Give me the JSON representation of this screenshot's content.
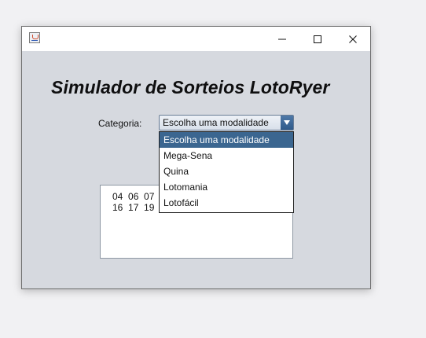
{
  "window": {
    "controls": {
      "minimize_glyph": "—",
      "maximize_glyph": "☐",
      "close_glyph": "✕"
    }
  },
  "app": {
    "title": "Simulador de Sorteios LotoRyer",
    "category_label": "Categoria:",
    "combo_selected": "Escolha uma modalidade"
  },
  "dropdown": {
    "items": [
      "Escolha uma modalidade",
      "Mega-Sena",
      "Quina",
      "Lotomania",
      "Lotofácil"
    ],
    "selected_index": 0
  },
  "results": {
    "line1": "04  06  07",
    "line2": "16  17  19"
  },
  "colors": {
    "selected_bg": "#3b6690",
    "window_bg": "#d6d9df"
  },
  "icons": {
    "app": "java-app-icon",
    "arrow": "chevron-down-icon"
  }
}
